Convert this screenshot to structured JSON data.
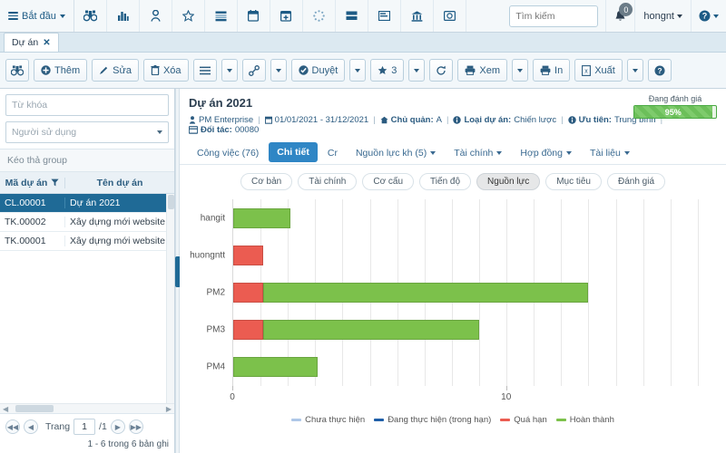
{
  "topbar": {
    "start_label": "Bắt đầu",
    "icons": [
      {
        "name": "binoculars-icon"
      },
      {
        "name": "bar-chart-icon"
      },
      {
        "name": "user-icon"
      },
      {
        "name": "star-icon"
      },
      {
        "name": "list-icon"
      },
      {
        "name": "calendar-icon"
      },
      {
        "name": "calendar-plus-icon"
      },
      {
        "name": "spinner-icon"
      },
      {
        "name": "card-icon"
      },
      {
        "name": "layout-icon"
      },
      {
        "name": "bank-icon"
      },
      {
        "name": "contract-icon"
      }
    ],
    "search_placeholder": "Tìm kiếm",
    "notification_count": "0",
    "user_name": "hongnt"
  },
  "doctab": {
    "label": "Dự án",
    "close": "✕"
  },
  "toolbar": {
    "search_icon": "binoculars-icon",
    "add_label": "Thêm",
    "edit_label": "Sửa",
    "delete_label": "Xóa",
    "approve_label": "Duyệt",
    "star_count": "3",
    "view_label": "Xem",
    "print_label": "In",
    "export_label": "Xuất"
  },
  "sidebar": {
    "keyword_placeholder": "Từ khóa",
    "user_select_value": "Người sử dụng",
    "group_hint": "Kéo thả group",
    "columns": [
      "Mã dự án",
      "Tên dự án"
    ],
    "rows": [
      {
        "code": "CL.00001",
        "name": "Dự án 2021",
        "selected": true
      },
      {
        "code": "TK.00002",
        "name": "Xây dựng mới website cho TCT",
        "selected": false
      },
      {
        "code": "TK.00001",
        "name": "Xây dựng mới website cho TCT",
        "selected": false
      }
    ],
    "pager": {
      "label": "Trang",
      "page_value": "1",
      "total_pages": "/1",
      "info": "1 - 6 trong 6 bản ghi"
    }
  },
  "project": {
    "title": "Dự án 2021",
    "meta": [
      {
        "icon": "user-icon",
        "key": "",
        "value": "PM Enterprise"
      },
      {
        "icon": "calendar-icon",
        "key": "",
        "value": "01/01/2021 - 31/12/2021"
      },
      {
        "icon": "home-icon",
        "key": "Chủ quản:",
        "value": "A"
      },
      {
        "icon": "info-icon",
        "key": "Loại dự án:",
        "value": "Chiến lược"
      },
      {
        "icon": "info-icon",
        "key": "Ưu tiên:",
        "value": "Trung bình"
      },
      {
        "icon": "card-icon",
        "key": "Đối tác:",
        "value": "00080"
      }
    ],
    "status_label": "Đang đánh giá",
    "progress_percent": "95%"
  },
  "tabs": [
    {
      "label": "Công việc (76)",
      "active": false,
      "caret": false
    },
    {
      "label": "Chi tiết",
      "active": true,
      "caret": false
    },
    {
      "label": "Cr",
      "active": false,
      "caret": false
    },
    {
      "label": "Nguồn lực kh (5)",
      "active": false,
      "caret": true
    },
    {
      "label": "Tài chính",
      "active": false,
      "caret": true
    },
    {
      "label": "Hợp đồng",
      "active": false,
      "caret": true
    },
    {
      "label": "Tài liệu",
      "active": false,
      "caret": true
    }
  ],
  "pills": [
    {
      "label": "Cơ bản",
      "active": false
    },
    {
      "label": "Tài chính",
      "active": false
    },
    {
      "label": "Cơ cấu",
      "active": false
    },
    {
      "label": "Tiến độ",
      "active": false
    },
    {
      "label": "Nguồn lực",
      "active": true
    },
    {
      "label": "Mục tiêu",
      "active": false
    },
    {
      "label": "Đánh giá",
      "active": false
    }
  ],
  "chart_data": {
    "type": "bar",
    "orientation": "horizontal",
    "stacked": true,
    "title": "",
    "xlabel": "",
    "ylabel": "",
    "categories": [
      "hangit",
      "huongntt",
      "PM2",
      "PM3",
      "PM4"
    ],
    "xlim": [
      0,
      17.5
    ],
    "xticks": [
      0,
      10
    ],
    "xtick_labels": [
      "0",
      "10"
    ],
    "gridlines": [
      0,
      1,
      2,
      3,
      4,
      5,
      6,
      7,
      8,
      9,
      10,
      11,
      12,
      13,
      14,
      15,
      16,
      17
    ],
    "grid": true,
    "legend_position": "bottom",
    "series": [
      {
        "name": "Chưa thực hiện",
        "color": "#aec7e8",
        "values": [
          0,
          0,
          0,
          0,
          0
        ]
      },
      {
        "name": "Đang thực hiện (trong hạn)",
        "color": "#1f5fa8",
        "values": [
          0,
          0,
          0,
          0,
          0
        ]
      },
      {
        "name": "Quá hạn",
        "color": "#eb5c51",
        "values": [
          0,
          1.1,
          1.1,
          1.1,
          0
        ]
      },
      {
        "name": "Hoàn thành",
        "color": "#7cc14b",
        "values": [
          2.1,
          0,
          11.9,
          7.9,
          3.1
        ]
      }
    ]
  }
}
